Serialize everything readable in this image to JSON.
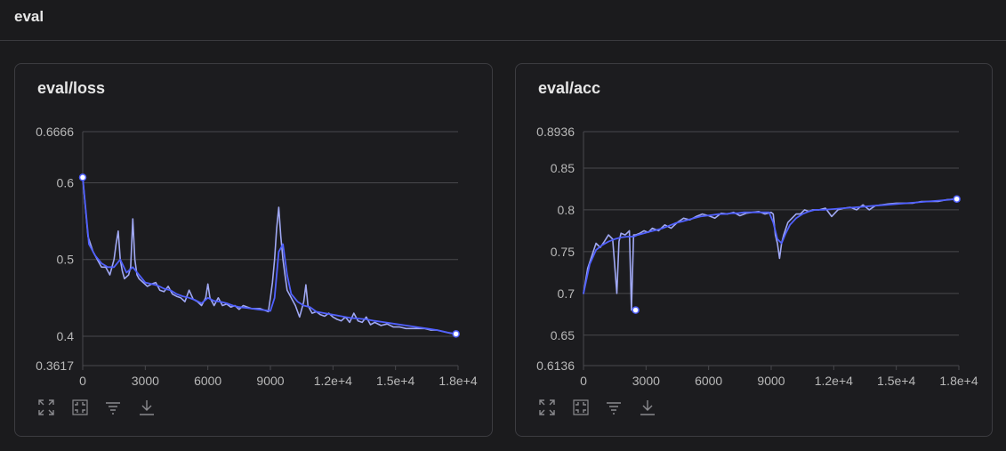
{
  "section": {
    "title": "eval"
  },
  "charts": [
    {
      "title": "eval/loss"
    },
    {
      "title": "eval/acc"
    }
  ],
  "toolbar_icons": [
    "expand-icon",
    "fit-icon",
    "filter-icon",
    "download-icon"
  ],
  "colors": {
    "smoothed": "#5060ff",
    "raw": "#a8b0ff",
    "grid": "#48484c",
    "background": "#1c1c1f"
  },
  "chart_data": [
    {
      "type": "line",
      "title": "eval/loss",
      "xlim": [
        0,
        18000
      ],
      "ylim": [
        0.3617,
        0.6666
      ],
      "x_ticks": [
        0,
        3000,
        6000,
        9000,
        12000,
        15000,
        18000
      ],
      "x_tick_labels": [
        "0",
        "3000",
        "6000",
        "9000",
        "1.2e+4",
        "1.5e+4",
        "1.8e+4"
      ],
      "y_ticks": [
        0.3617,
        0.4,
        0.5,
        0.6,
        0.6666
      ],
      "y_tick_labels": [
        "0.3617",
        "0.4",
        "0.5",
        "0.6",
        "0.6666"
      ],
      "grid": true,
      "series": [
        {
          "style": "raw",
          "x": [
            0,
            250,
            500,
            700,
            900,
            1100,
            1300,
            1500,
            1600,
            1700,
            1800,
            1900,
            2000,
            2200,
            2300,
            2400,
            2500,
            2600,
            2700,
            2900,
            3100,
            3300,
            3500,
            3700,
            3900,
            4100,
            4300,
            4500,
            4700,
            4900,
            5100,
            5300,
            5500,
            5700,
            5900,
            6000,
            6100,
            6300,
            6400,
            6500,
            6700,
            6900,
            7100,
            7300,
            7500,
            7700,
            7900,
            8100,
            8300,
            8500,
            8700,
            8900,
            9000,
            9100,
            9200,
            9300,
            9400,
            9500,
            9600,
            9700,
            9800,
            10000,
            10200,
            10400,
            10600,
            10700,
            10800,
            11000,
            11200,
            11400,
            11600,
            11800,
            12000,
            12200,
            12400,
            12600,
            12800,
            13000,
            13200,
            13400,
            13600,
            13800,
            14000,
            14300,
            14600,
            14900,
            15200,
            15500,
            15800,
            16100,
            16400,
            16700,
            17000,
            17300,
            17600,
            17900
          ],
          "y": [
            0.607,
            0.53,
            0.51,
            0.5,
            0.49,
            0.49,
            0.48,
            0.5,
            0.52,
            0.537,
            0.5,
            0.485,
            0.475,
            0.48,
            0.49,
            0.553,
            0.5,
            0.48,
            0.475,
            0.47,
            0.465,
            0.468,
            0.47,
            0.46,
            0.458,
            0.465,
            0.455,
            0.452,
            0.45,
            0.445,
            0.46,
            0.448,
            0.445,
            0.44,
            0.45,
            0.468,
            0.45,
            0.44,
            0.445,
            0.45,
            0.44,
            0.442,
            0.438,
            0.44,
            0.435,
            0.44,
            0.438,
            0.436,
            0.436,
            0.436,
            0.434,
            0.432,
            0.45,
            0.47,
            0.5,
            0.54,
            0.568,
            0.53,
            0.5,
            0.48,
            0.46,
            0.45,
            0.44,
            0.425,
            0.445,
            0.467,
            0.44,
            0.43,
            0.432,
            0.428,
            0.426,
            0.43,
            0.425,
            0.422,
            0.42,
            0.425,
            0.418,
            0.43,
            0.42,
            0.418,
            0.425,
            0.415,
            0.418,
            0.414,
            0.416,
            0.412,
            0.412,
            0.41,
            0.41,
            0.41,
            0.41,
            0.408,
            0.408,
            0.406,
            0.404,
            0.403
          ]
        },
        {
          "style": "smoothed",
          "x": [
            0,
            300,
            600,
            900,
            1200,
            1500,
            1800,
            2100,
            2400,
            2700,
            3000,
            3300,
            3600,
            3900,
            4200,
            4500,
            4800,
            5100,
            5400,
            5700,
            6000,
            6300,
            6600,
            6900,
            7200,
            7500,
            7800,
            8100,
            8400,
            8700,
            9000,
            9200,
            9400,
            9600,
            9800,
            10000,
            10300,
            10600,
            10900,
            11200,
            11600,
            12000,
            12400,
            12800,
            13200,
            13600,
            14000,
            14500,
            15000,
            15500,
            16000,
            16500,
            17000,
            17500,
            17900
          ],
          "y": [
            0.607,
            0.52,
            0.505,
            0.495,
            0.49,
            0.49,
            0.5,
            0.483,
            0.49,
            0.48,
            0.47,
            0.468,
            0.466,
            0.462,
            0.46,
            0.455,
            0.452,
            0.45,
            0.447,
            0.443,
            0.45,
            0.446,
            0.445,
            0.443,
            0.44,
            0.438,
            0.437,
            0.436,
            0.435,
            0.434,
            0.433,
            0.45,
            0.51,
            0.52,
            0.48,
            0.455,
            0.445,
            0.44,
            0.438,
            0.432,
            0.43,
            0.428,
            0.426,
            0.424,
            0.423,
            0.422,
            0.42,
            0.418,
            0.416,
            0.414,
            0.412,
            0.41,
            0.408,
            0.405,
            0.403
          ]
        }
      ],
      "markers": [
        {
          "x": 0,
          "y": 0.607
        },
        {
          "x": 17900,
          "y": 0.403
        }
      ]
    },
    {
      "type": "line",
      "title": "eval/acc",
      "xlim": [
        0,
        18000
      ],
      "ylim": [
        0.6136,
        0.8936
      ],
      "x_ticks": [
        0,
        3000,
        6000,
        9000,
        12000,
        15000,
        18000
      ],
      "x_tick_labels": [
        "0",
        "3000",
        "6000",
        "9000",
        "1.2e+4",
        "1.5e+4",
        "1.8e+4"
      ],
      "y_ticks": [
        0.6136,
        0.65,
        0.7,
        0.75,
        0.8,
        0.85,
        0.8936
      ],
      "y_tick_labels": [
        "0.6136",
        "0.65",
        "0.7",
        "0.75",
        "0.8",
        "0.85",
        "0.8936"
      ],
      "grid": true,
      "series": [
        {
          "style": "raw",
          "x": [
            0,
            200,
            400,
            600,
            800,
            1000,
            1200,
            1400,
            1600,
            1700,
            1800,
            2000,
            2200,
            2300,
            2400,
            2500,
            2700,
            2900,
            3100,
            3300,
            3600,
            3900,
            4200,
            4500,
            4800,
            5100,
            5400,
            5700,
            6000,
            6300,
            6600,
            6900,
            7200,
            7500,
            7800,
            8100,
            8400,
            8700,
            9000,
            9100,
            9200,
            9300,
            9400,
            9500,
            9600,
            9800,
            10000,
            10200,
            10400,
            10600,
            10800,
            11000,
            11300,
            11600,
            11900,
            12200,
            12500,
            12800,
            13100,
            13400,
            13700,
            14000,
            14300,
            14600,
            15000,
            15400,
            15800,
            16200,
            16600,
            17000,
            17400,
            17900
          ],
          "y": [
            0.7,
            0.73,
            0.745,
            0.76,
            0.755,
            0.762,
            0.77,
            0.765,
            0.7,
            0.762,
            0.772,
            0.77,
            0.775,
            0.68,
            0.77,
            0.77,
            0.772,
            0.775,
            0.773,
            0.778,
            0.775,
            0.782,
            0.778,
            0.785,
            0.79,
            0.788,
            0.792,
            0.795,
            0.793,
            0.79,
            0.796,
            0.795,
            0.797,
            0.793,
            0.796,
            0.797,
            0.798,
            0.795,
            0.797,
            0.795,
            0.77,
            0.76,
            0.742,
            0.76,
            0.77,
            0.785,
            0.79,
            0.795,
            0.795,
            0.8,
            0.798,
            0.8,
            0.8,
            0.802,
            0.792,
            0.8,
            0.802,
            0.803,
            0.8,
            0.806,
            0.8,
            0.805,
            0.806,
            0.807,
            0.808,
            0.808,
            0.808,
            0.81,
            0.81,
            0.81,
            0.812,
            0.813
          ]
        },
        {
          "style": "smoothed",
          "x": [
            0,
            300,
            600,
            900,
            1200,
            1500,
            1800,
            2100,
            2400,
            2600,
            2900,
            3200,
            3500,
            3800,
            4100,
            4400,
            4700,
            5000,
            5300,
            5600,
            5900,
            6200,
            6500,
            6800,
            7100,
            7400,
            7700,
            8000,
            8300,
            8600,
            8900,
            9100,
            9300,
            9500,
            9700,
            9900,
            10200,
            10500,
            10800,
            11100,
            11500,
            12000,
            12500,
            13000,
            13500,
            14000,
            14500,
            15000,
            15500,
            16000,
            16500,
            17000,
            17500,
            17900
          ],
          "y": [
            0.7,
            0.735,
            0.752,
            0.758,
            0.762,
            0.765,
            0.767,
            0.768,
            0.768,
            0.77,
            0.772,
            0.774,
            0.776,
            0.778,
            0.781,
            0.784,
            0.786,
            0.788,
            0.79,
            0.792,
            0.793,
            0.794,
            0.795,
            0.795,
            0.796,
            0.796,
            0.797,
            0.797,
            0.797,
            0.797,
            0.797,
            0.785,
            0.765,
            0.76,
            0.772,
            0.782,
            0.79,
            0.795,
            0.798,
            0.8,
            0.8,
            0.801,
            0.802,
            0.803,
            0.804,
            0.805,
            0.806,
            0.807,
            0.808,
            0.809,
            0.81,
            0.811,
            0.812,
            0.813
          ]
        }
      ],
      "markers": [
        {
          "x": 2500,
          "y": 0.68
        },
        {
          "x": 17900,
          "y": 0.813
        }
      ]
    }
  ]
}
